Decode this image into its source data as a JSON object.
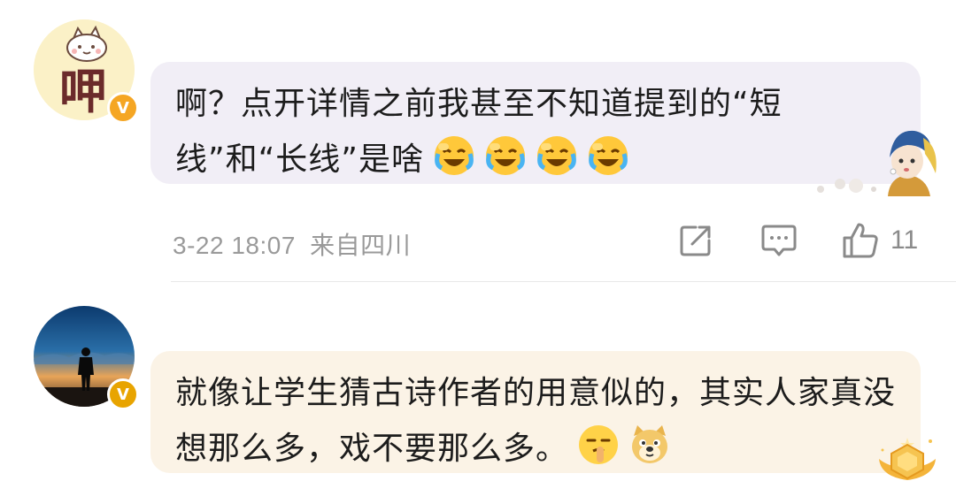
{
  "comments": [
    {
      "text": "啊？点开详情之前我甚至不知道提到的“短线”和“长线”是啥",
      "emojis": [
        "laughing-crying-icon",
        "laughing-crying-icon",
        "laughing-crying-icon",
        "laughing-crying-icon"
      ],
      "badge_label": "V",
      "badge_color": "#f5a623",
      "avatar_text": "呷",
      "timestamp": "3-22 18:07",
      "location": "来自四川",
      "like_count": "11",
      "bubble_color": "#f1eef6"
    },
    {
      "text": "就像让学生猜古诗作者的用意似的，其实人家真没想那么多，戏不要那么多。",
      "emojis": [
        "hush-face-icon",
        "doge-icon"
      ],
      "badge_label": "V",
      "badge_color": "#e8a400",
      "bubble_color": "#fbf3e6"
    }
  ],
  "icons": {
    "share": "share-icon",
    "reply": "comment-icon",
    "like": "thumbs-up-icon"
  }
}
